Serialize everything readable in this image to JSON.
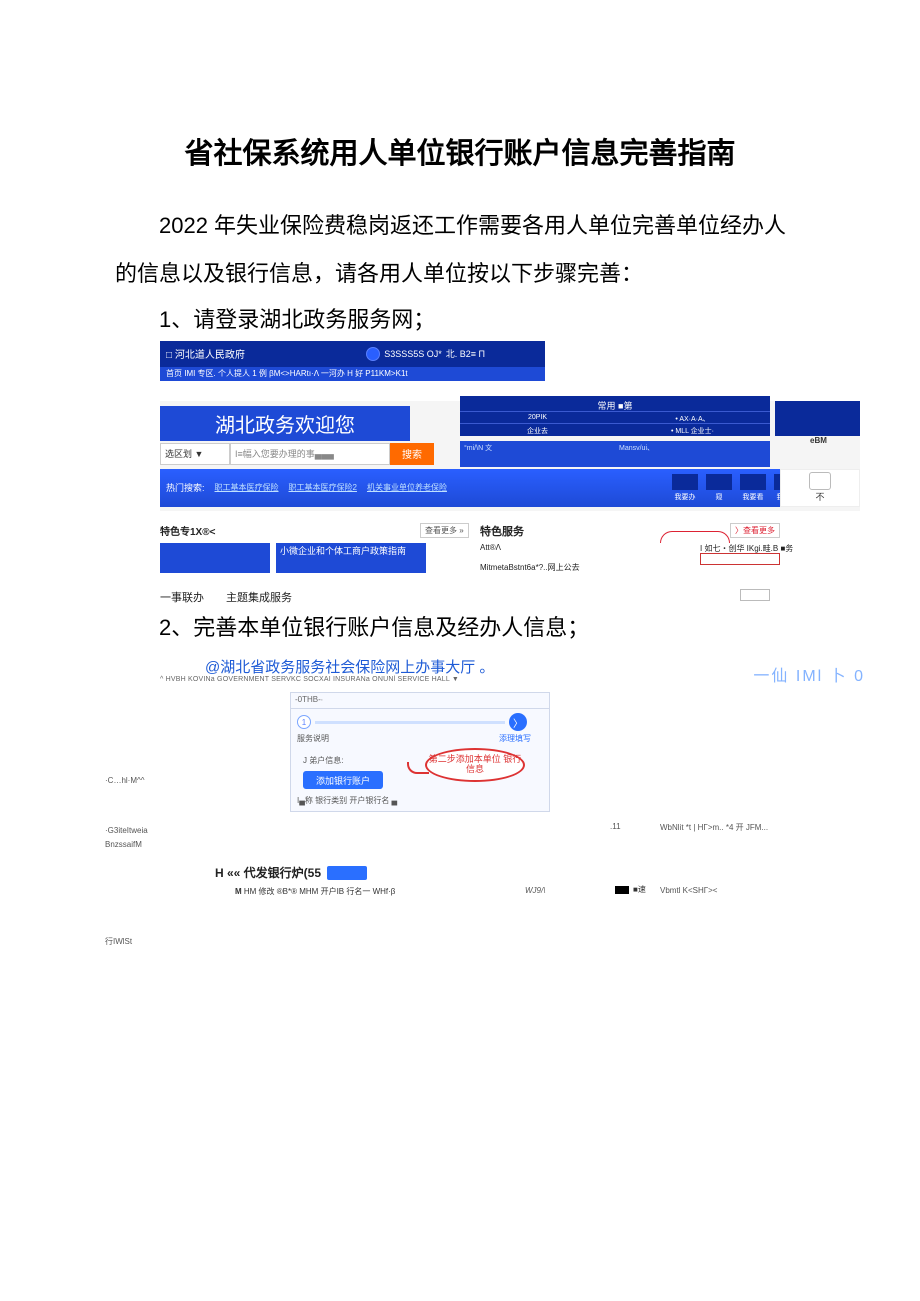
{
  "title": "省社保系统用人单位银行账户信息完善指南",
  "intro": "2022 年失业保险费稳岗返还工作需要各用人单位完善单位经办人的信息以及银行信息，请各用人单位按以下步骤完善：",
  "step1": "1、请登录湖北政务服务网；",
  "step2": "2、完善本单位银行账户信息及经办人信息；",
  "shot1": {
    "gov": "河北道人民政府",
    "top_badge": "S3SSS5S OJ*",
    "top_badge_suffix": "北. B2≡ Π",
    "nav": "首页 IMI 专区. 个人提人 1 例 βM<>HARtı·Λ 一河办 H 好 P11KM>K1t",
    "welcome": "湖北政务欢迎您",
    "common_top": "常用 ■第",
    "common_r1a": "20PIK",
    "common_r1b": "• AX·A·A、",
    "common_r2a": "企业去",
    "common_r2b": "• MLL 企业士·",
    "sel": "选区划 ▼",
    "search_ph": "I≡幅入您要办理的事▄▄▄",
    "search_btn": "搜索",
    "search_m_l": "°mi/\\N 文",
    "search_m_r": "Mansv/ui、",
    "ebm": "eBM",
    "hot_label": "热门搜索:",
    "hot1": "职工基本医疗保险",
    "hot2": "职工基本医疗保险2",
    "hot3": "机关事业单位养老保险",
    "hotbox1": "我要办",
    "hotbox2": "窥",
    "hotbox3": "我要看",
    "hotbox4": "我要评",
    "hotright_txt": "不",
    "tese_left": "特色专1X®<",
    "more1": "查看更多 »",
    "tese_mid": "特色服务",
    "more2": "查看更多",
    "card2": "小微企业和个体工商户政策指南",
    "mid1": "Att®Λ",
    "mid2": "MitmetaBstnt6a*?..网上公去",
    "right_top": "I 如七・创华 IKgi.畦.B ■务",
    "bottom1": "一事联办",
    "bottom2": "主题集成服务"
  },
  "shot2": {
    "title": "@湖北省政务服务社会保险网上办事大厅 。",
    "sub": "^ HVBH KOVINa GOVERNMENT SERVKC SOCXAI INSURANa ONUNl SERVICE HALL ▼",
    "right": "一仙 IMl 卜 0",
    "panel_hdr": "-0THB-∙",
    "step1": "1",
    "step2": "〉",
    "lbl1": "服务说明",
    "lbl2": "添理填写",
    "acc": "J 弟户信息:",
    "btn": "添加银行账户",
    "cols": "I▄称      银行类别   开户银行名      ▄",
    "bubble": "第二步添加本单位\n银行信息",
    "left1": "·C…hl·M^^",
    "left2": "·G3iteItweia",
    "left3": "BnzssaifM",
    "far1": ".11",
    "far2": "WbNlit *t | HΓ>m.. *4 开 JFM...",
    "h2": "H «« 代发银行炉(55",
    "cols2_m": "M",
    "cols2": " HM 修改 ®B*® MHM 开户IB 行名一 WHf·β",
    "mid2": "WJ9/\\",
    "right2": "Vbmtl K<SHГ><",
    "sq_label": "■速",
    "foot": "行IWlSt"
  }
}
